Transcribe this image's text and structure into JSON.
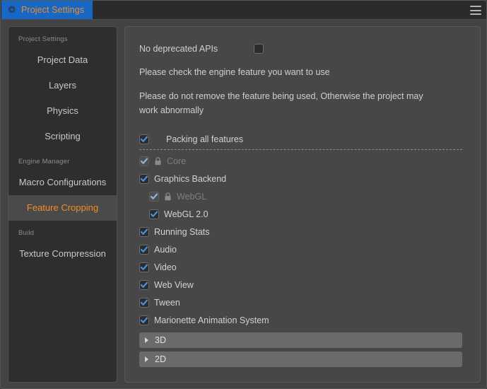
{
  "titlebar": {
    "tab_label": "Project Settings",
    "gear_icon": "gear-icon",
    "menu_icon": "hamburger-menu-icon"
  },
  "sidebar": {
    "groups": [
      {
        "title": "Project Settings",
        "items": [
          {
            "label": "Project Data",
            "selected": false
          },
          {
            "label": "Layers",
            "selected": false
          },
          {
            "label": "Physics",
            "selected": false
          },
          {
            "label": "Scripting",
            "selected": false
          }
        ]
      },
      {
        "title": "Engine Manager",
        "items": [
          {
            "label": "Macro Configurations",
            "selected": false
          },
          {
            "label": "Feature Cropping",
            "selected": true
          }
        ]
      },
      {
        "title": "Build",
        "items": [
          {
            "label": "Texture Compression",
            "selected": false
          }
        ]
      }
    ]
  },
  "main": {
    "deprecated": {
      "label": "No deprecated APIs",
      "checked": false
    },
    "notes": [
      "Please check the engine feature you want to use",
      "Please do not remove the feature being used, Otherwise the project may work abnormally"
    ],
    "packing_all": {
      "label": "Packing all features",
      "checked": true
    },
    "features": [
      {
        "label": "Core",
        "checked": true,
        "disabled": true,
        "locked": true,
        "indent": false
      },
      {
        "label": "Graphics Backend",
        "checked": true,
        "disabled": false,
        "locked": false,
        "indent": false
      },
      {
        "label": "WebGL",
        "checked": true,
        "disabled": true,
        "locked": true,
        "indent": true
      },
      {
        "label": "WebGL 2.0",
        "checked": true,
        "disabled": false,
        "locked": false,
        "indent": true
      },
      {
        "label": "Running Stats",
        "checked": true,
        "disabled": false,
        "locked": false,
        "indent": false
      },
      {
        "label": "Audio",
        "checked": true,
        "disabled": false,
        "locked": false,
        "indent": false
      },
      {
        "label": "Video",
        "checked": true,
        "disabled": false,
        "locked": false,
        "indent": false
      },
      {
        "label": "Web View",
        "checked": true,
        "disabled": false,
        "locked": false,
        "indent": false
      },
      {
        "label": "Tween",
        "checked": true,
        "disabled": false,
        "locked": false,
        "indent": false
      },
      {
        "label": "Marionette Animation System",
        "checked": true,
        "disabled": false,
        "locked": false,
        "indent": false
      }
    ],
    "sections": [
      {
        "label": "3D",
        "expanded": false
      },
      {
        "label": "2D",
        "expanded": false
      }
    ]
  },
  "colors": {
    "accent_orange": "#f08b28",
    "tab_blue": "#1668c4",
    "checkbox_blue": "#4a90e2",
    "window_bg": "#434343",
    "panel_bg": "#474747",
    "sidebar_bg": "#2e2e2e"
  }
}
